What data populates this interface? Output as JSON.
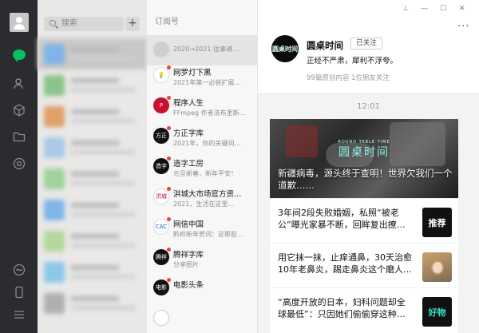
{
  "search": {
    "placeholder": "搜索",
    "plus": "+"
  },
  "chat_list": {
    "item_count": 9
  },
  "subscriptions": {
    "header": "订阅号",
    "items": [
      {
        "name": "",
        "desc": "2020→2021 往事请…",
        "logo": ""
      },
      {
        "name": "网罗灯下黑",
        "desc": "2021年第一必装扩展…",
        "logo": "💡"
      },
      {
        "name": "程序人生",
        "desc": "FFmpeg 作者法布里斯…",
        "logo": "P"
      },
      {
        "name": "方正字库",
        "desc": "2021年，你的关键词…",
        "logo": "方正"
      },
      {
        "name": "造字工房",
        "desc": "元旦新春，新年平安！",
        "logo": "造字"
      },
      {
        "name": "洪城大市场官方资…",
        "desc": "2021，生活在这里…",
        "logo": "洪城"
      },
      {
        "name": "网信中国",
        "desc": "黔桥新年贺词：这那些…",
        "logo": "CAC"
      },
      {
        "name": "腾祥字库",
        "desc": "分享图片",
        "logo": "腾祥"
      },
      {
        "name": "电影头条",
        "desc": "",
        "logo": "电影"
      }
    ]
  },
  "reader": {
    "window_controls": {
      "pin": "⊥",
      "minimize": "—",
      "maximize": "☐",
      "close": "✕"
    },
    "more": "···",
    "account": {
      "logo_text": "圆桌时间",
      "name": "圆桌时间",
      "follow_label": "已关注",
      "slogan": "正经不严肃，犀利不浮夸。",
      "stats": "99篇原创内容   1位朋友关注"
    },
    "time": "12:01",
    "cover": {
      "brand": "圆桌时间",
      "brand_sub": "ROUND TABLE TIME",
      "headline": "新疆病毒，源头终于查明！世界欠我们一个道歉……"
    },
    "articles": [
      {
        "title": "3年间2段失败婚姻，私照“被老公”曝光家暴不断，回眸复出撩…",
        "thumb": "推荐"
      },
      {
        "title": "用它抹一抹，止痒通鼻，30天治愈10年老鼻炎，踢走鼻炎这个磨人…",
        "thumb": ""
      },
      {
        "title": "“高度开放的日本，妇科问题却全球最低”：只因她们偷偷穿这种…",
        "thumb": "好物"
      }
    ]
  }
}
